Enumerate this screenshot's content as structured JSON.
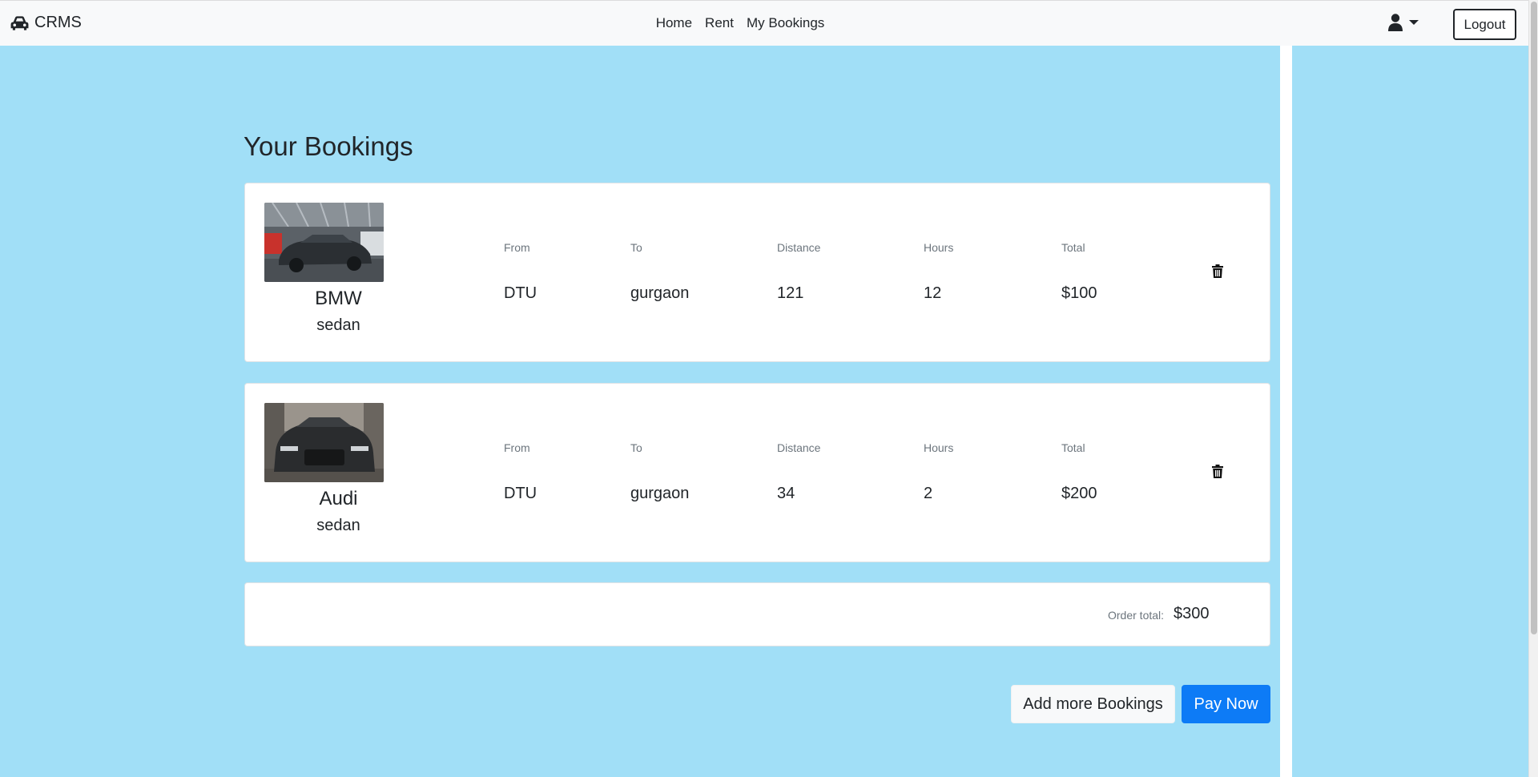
{
  "navbar": {
    "brand": "CRMS",
    "links": [
      "Home",
      "Rent",
      "My Bookings"
    ],
    "logout_label": "Logout"
  },
  "page": {
    "title": "Your Bookings"
  },
  "columns": {
    "from": "From",
    "to": "To",
    "distance": "Distance",
    "hours": "Hours",
    "total": "Total"
  },
  "bookings": [
    {
      "car_name": "BMW",
      "car_type": "sedan",
      "from": "DTU",
      "to": "gurgaon",
      "distance": "121",
      "hours": "12",
      "total": "$100"
    },
    {
      "car_name": "Audi",
      "car_type": "sedan",
      "from": "DTU",
      "to": "gurgaon",
      "distance": "34",
      "hours": "2",
      "total": "$200"
    }
  ],
  "order": {
    "total_label": "Order total:",
    "total_value": "$300"
  },
  "actions": {
    "add_more_label": "Add more Bookings",
    "pay_now_label": "Pay Now"
  },
  "colors": {
    "page_background": "#a1dff7",
    "primary": "#0d7bf6",
    "navbar_background": "#f8f9fa"
  }
}
